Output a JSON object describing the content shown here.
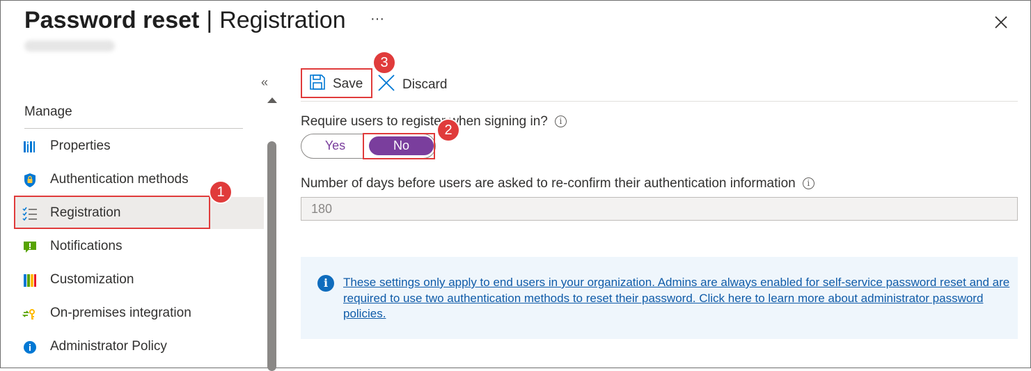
{
  "header": {
    "title_bold": "Password reset",
    "title_sep": "|",
    "title_sub": "Registration",
    "more_label": "···"
  },
  "sidebar": {
    "collapse_label": "«",
    "section": "Manage",
    "items": [
      {
        "label": "Properties",
        "icon": "properties-icon",
        "active": false
      },
      {
        "label": "Authentication methods",
        "icon": "shield-icon",
        "active": false
      },
      {
        "label": "Registration",
        "icon": "registration-list-icon",
        "active": true
      },
      {
        "label": "Notifications",
        "icon": "notification-icon",
        "active": false
      },
      {
        "label": "Customization",
        "icon": "customization-icon",
        "active": false
      },
      {
        "label": "On-premises integration",
        "icon": "sync-key-icon",
        "active": false
      },
      {
        "label": "Administrator Policy",
        "icon": "info-icon",
        "active": false
      }
    ]
  },
  "toolbar": {
    "save_label": "Save",
    "discard_label": "Discard"
  },
  "form": {
    "require_register_label": "Require users to register when signing in?",
    "yes_label": "Yes",
    "no_label": "No",
    "selected": "No",
    "days_label": "Number of days before users are asked to re-confirm their authentication information",
    "days_value": "180"
  },
  "info_box": {
    "message": "These settings only apply to end users in your organization. Admins are always enabled for self-service password reset and are required to use two authentication methods to reset their password. Click here to learn more about administrator password policies."
  },
  "annotations": {
    "step1": "1",
    "step2": "2",
    "step3": "3"
  },
  "colors": {
    "accent_purple": "#7a3e9d",
    "link_blue": "#0f5ba8",
    "annotation_red": "#e03b3b"
  }
}
